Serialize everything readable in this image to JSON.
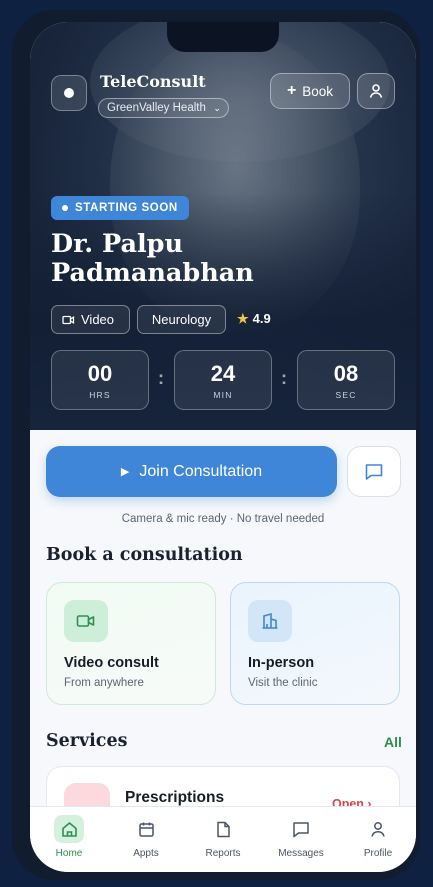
{
  "header": {
    "brand_name": "TeleConsult",
    "clinic": "GreenValley Health",
    "book_label": "Book"
  },
  "doctor": {
    "status": "STARTING SOON",
    "name": "Dr. Palpu Padmanabhan",
    "mode": "Video",
    "specialty": "Neurology",
    "rating": "4.9"
  },
  "countdown": {
    "hours": "00",
    "hours_label": "HRS",
    "minutes": "24",
    "minutes_label": "MIN",
    "seconds": "08",
    "seconds_label": "SEC"
  },
  "actions": {
    "join_label": "Join Consultation",
    "ready_text": "Camera & mic ready · No travel needed"
  },
  "booking": {
    "title": "Book a consultation",
    "options": [
      {
        "title": "Video consult",
        "subtitle": "From anywhere",
        "icon": "video-camera-icon"
      },
      {
        "title": "In-person",
        "subtitle": "Visit the clinic",
        "icon": "building-icon"
      }
    ]
  },
  "services": {
    "title": "Services",
    "all_label": "All",
    "items": [
      {
        "title": "Prescriptions",
        "status": "Open ›"
      }
    ]
  },
  "tabs": [
    {
      "label": "Home",
      "icon": "home-icon",
      "active": true
    },
    {
      "label": "Appts",
      "icon": "calendar-icon",
      "active": false
    },
    {
      "label": "Reports",
      "icon": "document-icon",
      "active": false
    },
    {
      "label": "Messages",
      "icon": "chat-icon",
      "active": false
    },
    {
      "label": "Profile",
      "icon": "user-icon",
      "active": false
    }
  ],
  "colors": {
    "accent_blue": "#3f86d9",
    "accent_green": "#2f8f52",
    "alert_red": "#d9464d",
    "star": "#f5c54a"
  }
}
